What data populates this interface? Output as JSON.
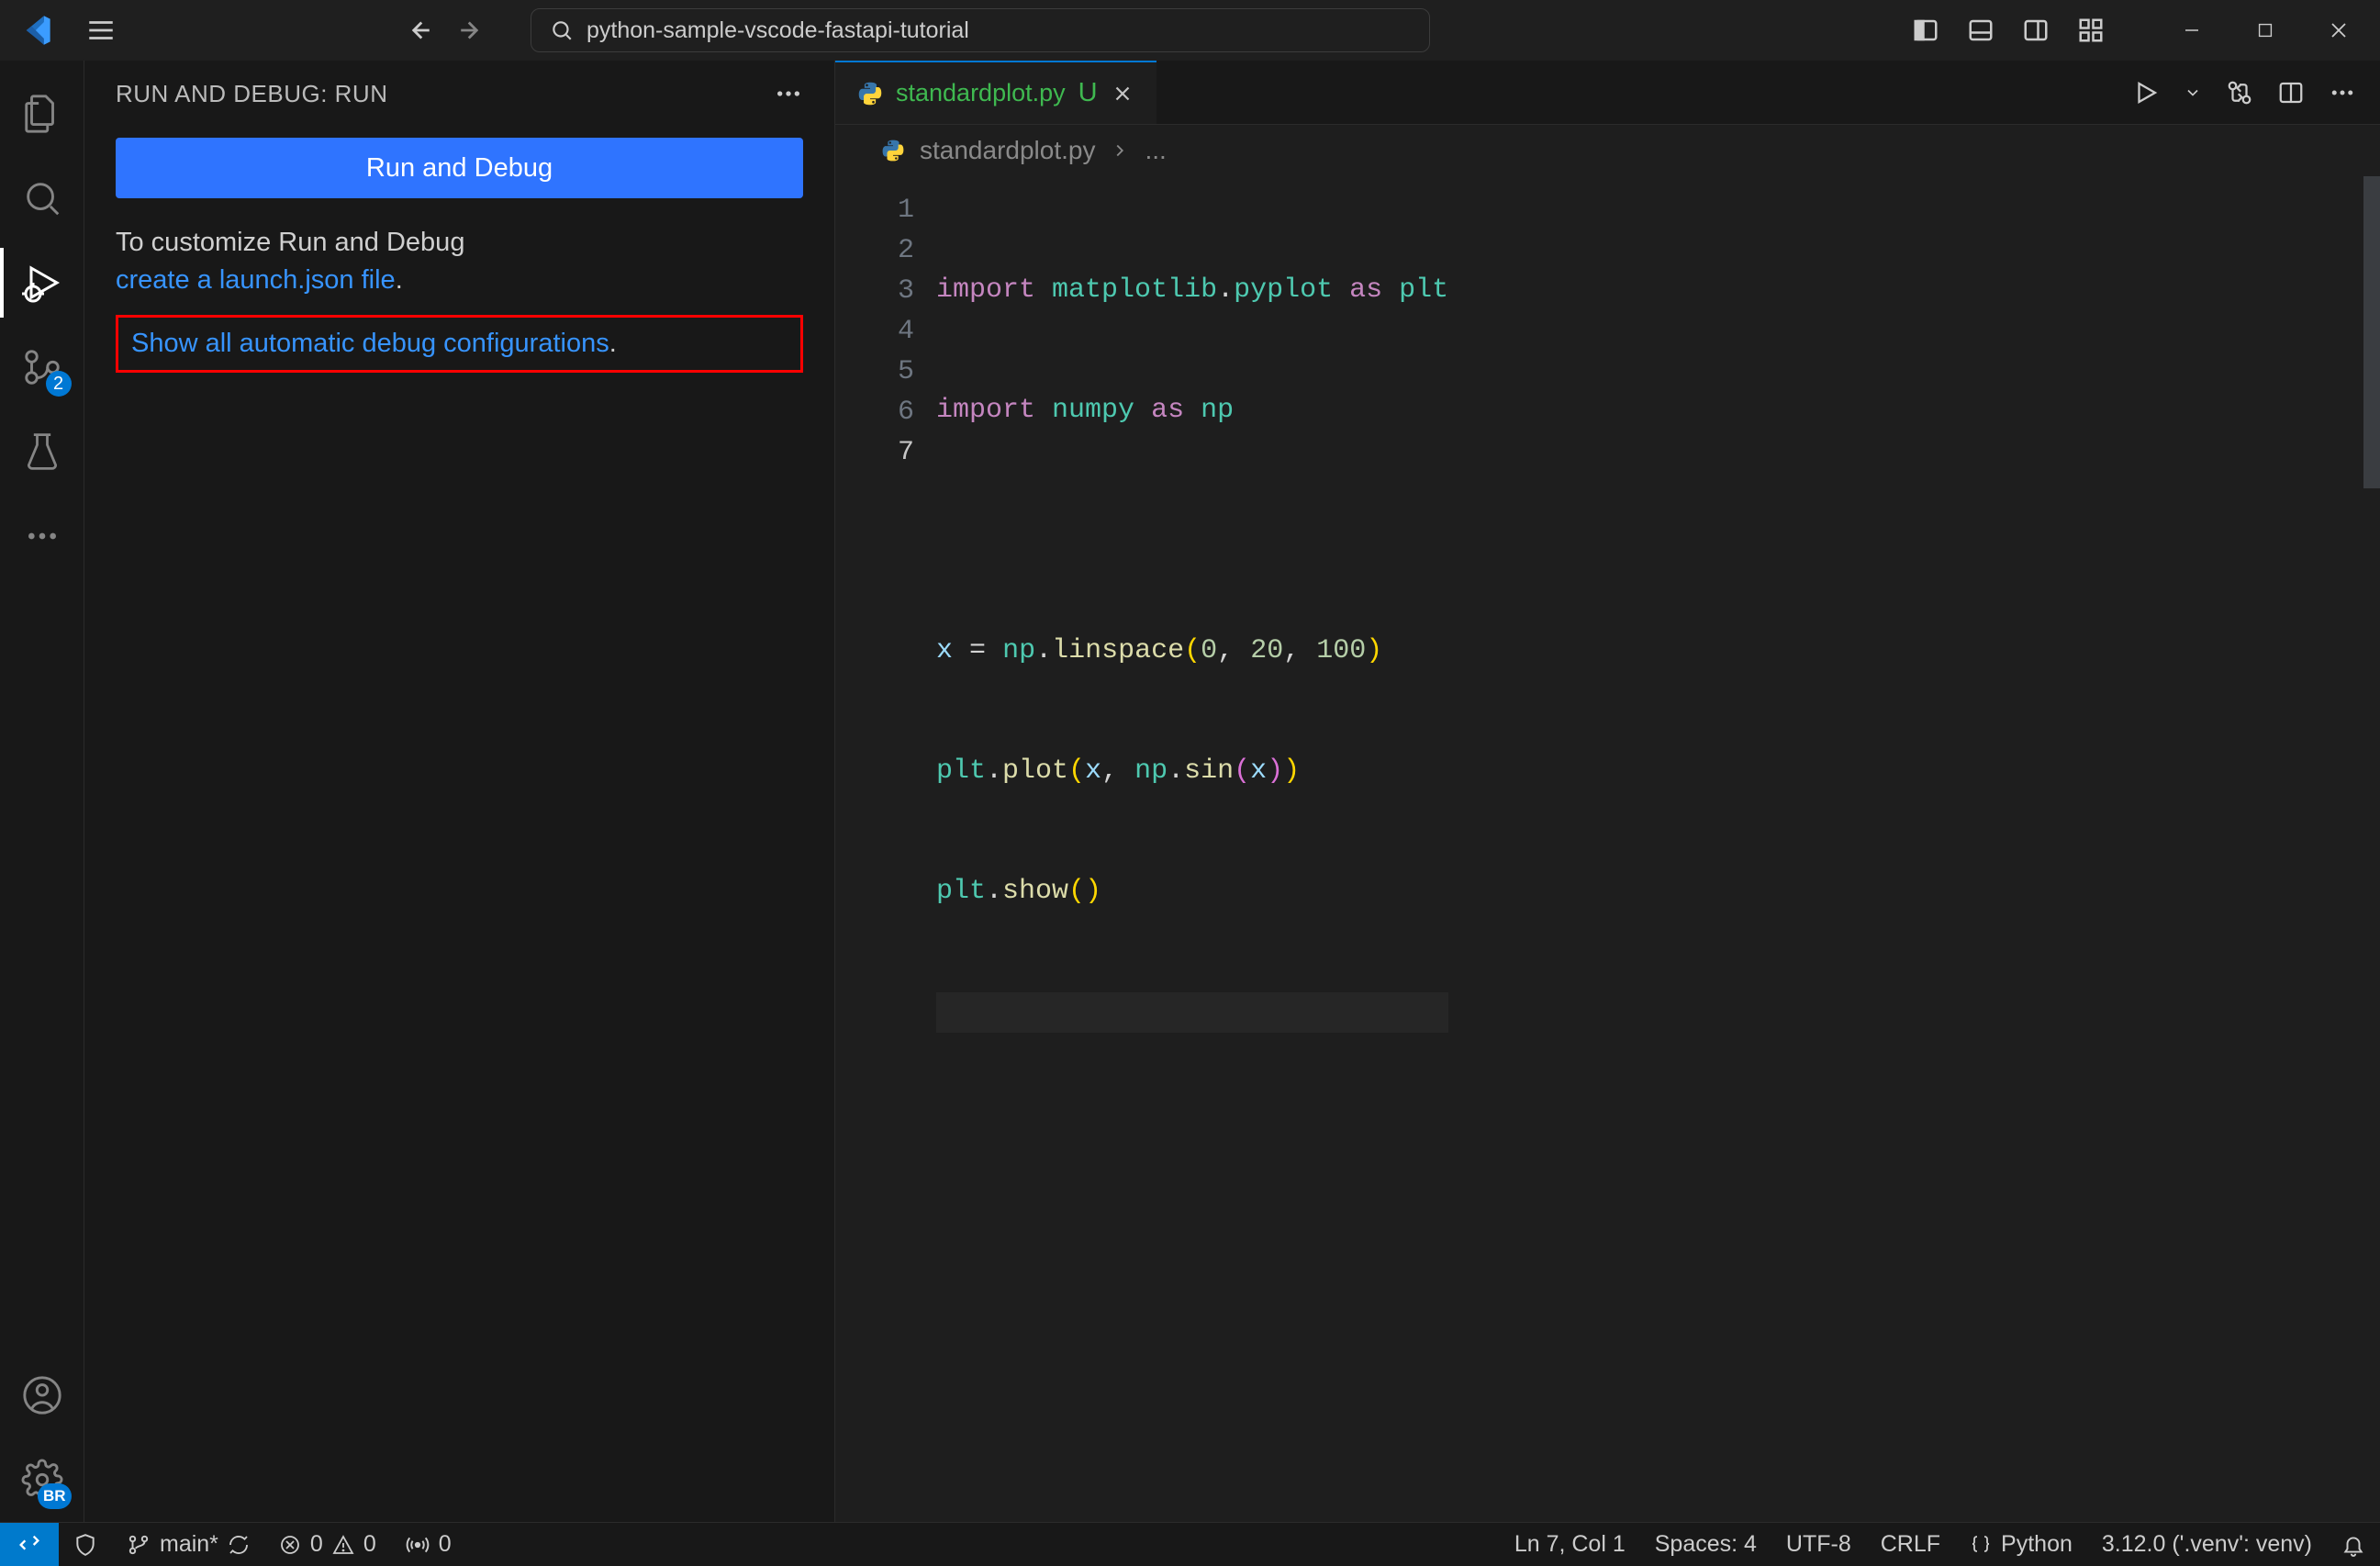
{
  "titlebar": {
    "searchText": "python-sample-vscode-fastapi-tutorial"
  },
  "activitybar": {
    "scmBadge": "2",
    "settingsBadge": "BR"
  },
  "sidebar": {
    "title": "RUN AND DEBUG: RUN",
    "runButton": "Run and Debug",
    "customizeText": "To customize Run and Debug ",
    "createLink": "create a launch.json file",
    "period": ".",
    "showAllText": "Show all automatic debug configurations",
    "showAllPeriod": "."
  },
  "editor": {
    "tabFile": "standardplot.py",
    "tabMod": "U",
    "breadcrumbFile": "standardplot.py",
    "breadcrumbMore": "...",
    "lines": [
      "1",
      "2",
      "3",
      "4",
      "5",
      "6",
      "7"
    ],
    "code": {
      "l1": {
        "kw1": "import",
        "sp1": " ",
        "mod": "matplotlib",
        "dot": ".",
        "sub": "pyplot",
        "sp2": " ",
        "kw2": "as",
        "sp3": " ",
        "alias": "plt"
      },
      "l2": {
        "kw1": "import",
        "sp1": " ",
        "mod": "numpy",
        "sp2": " ",
        "kw2": "as",
        "sp3": " ",
        "alias": "np"
      },
      "l4": {
        "var": "x",
        "sp1": " ",
        "eq": "=",
        "sp2": " ",
        "obj": "np",
        "dot": ".",
        "fn": "linspace",
        "po": "(",
        "a1": "0",
        "c1": ",",
        "sp3": " ",
        "a2": "20",
        "c2": ",",
        "sp4": " ",
        "a3": "100",
        "pc": ")"
      },
      "l5": {
        "obj": "plt",
        "dot": ".",
        "fn": "plot",
        "po": "(",
        "a1": "x",
        "c1": ",",
        "sp1": " ",
        "obj2": "np",
        "dot2": ".",
        "fn2": "sin",
        "po2": "(",
        "a2": "x",
        "pc2": ")",
        "pc": ")"
      },
      "l6": {
        "obj": "plt",
        "dot": ".",
        "fn": "show",
        "po": "(",
        "pc": ")"
      }
    }
  },
  "statusbar": {
    "branch": "main*",
    "errors": "0",
    "warnings": "0",
    "ports": "0",
    "lncol": "Ln 7, Col 1",
    "spaces": "Spaces: 4",
    "encoding": "UTF-8",
    "eol": "CRLF",
    "lang": "Python",
    "interp": "3.12.0 ('.venv': venv)"
  }
}
